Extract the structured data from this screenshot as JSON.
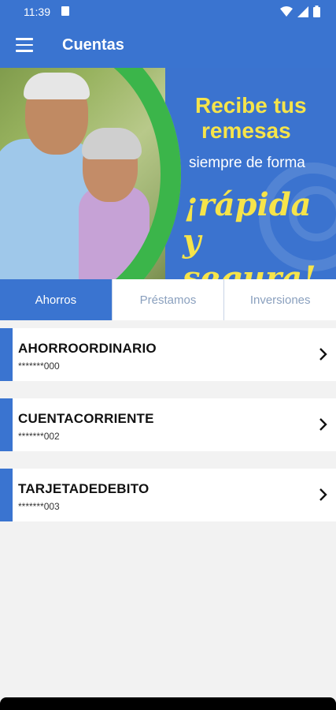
{
  "status_bar": {
    "time": "11:39"
  },
  "app_bar": {
    "title": "Cuentas"
  },
  "banner": {
    "line1": "Recibe tus",
    "line2": "remesas",
    "line3": "siempre de forma",
    "line4": "¡rápida",
    "line5": "y segura!"
  },
  "tabs": [
    {
      "label": "Ahorros",
      "active": true
    },
    {
      "label": "Préstamos",
      "active": false
    },
    {
      "label": "Inversiones",
      "active": false
    }
  ],
  "accounts": [
    {
      "name": "AHORROORDINARIO",
      "number": "*******000"
    },
    {
      "name": "CUENTACORRIENTE",
      "number": "*******002"
    },
    {
      "name": "TARJETADEDEBITO",
      "number": "*******003"
    }
  ],
  "colors": {
    "primary": "#3a74d0",
    "accent_green": "#3bb54a",
    "banner_yellow": "#f6e44a"
  },
  "icons": [
    "menu-icon",
    "sd-card-icon",
    "wifi-icon",
    "signal-icon",
    "battery-icon",
    "chevron-right-icon"
  ]
}
